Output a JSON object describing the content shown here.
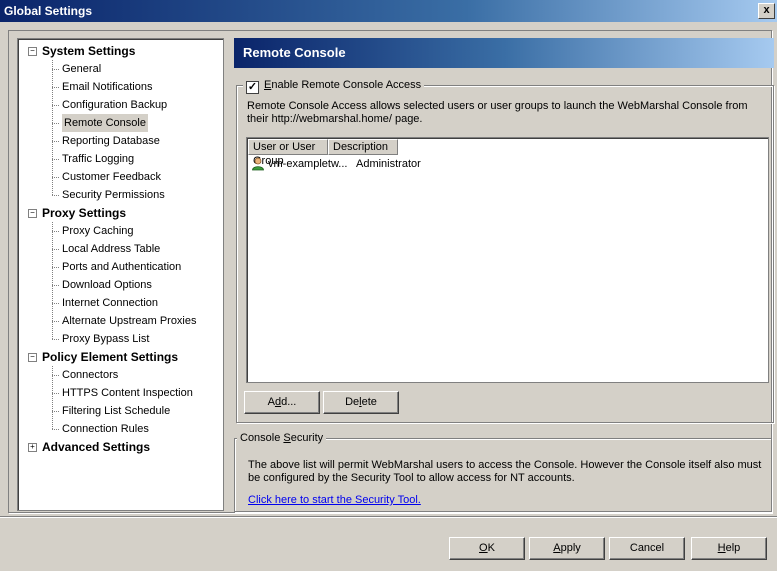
{
  "window": {
    "title": "Global Settings",
    "close_glyph": "x"
  },
  "tree": {
    "groups": [
      {
        "label": "System Settings",
        "expander": "−",
        "items": [
          "General",
          "Email Notifications",
          "Configuration Backup",
          "Remote Console",
          "Reporting Database",
          "Traffic Logging",
          "Customer Feedback",
          "Security Permissions"
        ]
      },
      {
        "label": "Proxy Settings",
        "expander": "−",
        "items": [
          "Proxy Caching",
          "Local Address Table",
          "Ports and Authentication",
          "Download Options",
          "Internet Connection",
          "Alternate Upstream Proxies",
          "Proxy Bypass List"
        ]
      },
      {
        "label": "Policy Element Settings",
        "expander": "−",
        "items": [
          "Connectors",
          "HTTPS Content Inspection",
          "Filtering List Schedule",
          "Connection Rules"
        ]
      },
      {
        "label": "Advanced Settings",
        "expander": "+",
        "items": []
      }
    ],
    "selected": "Remote Console"
  },
  "panel": {
    "title": "Remote Console",
    "enable": {
      "checked": true,
      "check_glyph": "✓",
      "label_pre": "",
      "label_u": "E",
      "label_post": "nable Remote Console Access"
    },
    "description": "Remote Console Access allows selected users or user groups to launch the WebMarshal Console from their http://webmarshal.home/ page.",
    "list": {
      "columns": [
        "User or User Group",
        "Description"
      ],
      "rows": [
        {
          "user": "vm-exampletw...",
          "description": "Administrator",
          "icon": "user-icon"
        }
      ]
    },
    "buttons": {
      "add": {
        "pre": "A",
        "u": "d",
        "post": "d..."
      },
      "delete": {
        "pre": "De",
        "u": "l",
        "post": "ete"
      }
    },
    "security": {
      "legend_pre": "Console ",
      "legend_u": "S",
      "legend_post": "ecurity",
      "text": "The above list will permit WebMarshal users to access the Console. However the Console itself also must be configured by the Security Tool to allow access for NT accounts.",
      "link": "Click here to start the Security Tool."
    }
  },
  "footer": {
    "ok": {
      "pre": "",
      "u": "O",
      "post": "K"
    },
    "apply": {
      "pre": "",
      "u": "A",
      "post": "pply"
    },
    "cancel": {
      "pre": "Cancel",
      "u": "",
      "post": ""
    },
    "help": {
      "pre": "",
      "u": "H",
      "post": "elp"
    }
  },
  "colors": {
    "title_start": "#0a246a",
    "title_end": "#a6caf0",
    "link": "#0000ee"
  }
}
